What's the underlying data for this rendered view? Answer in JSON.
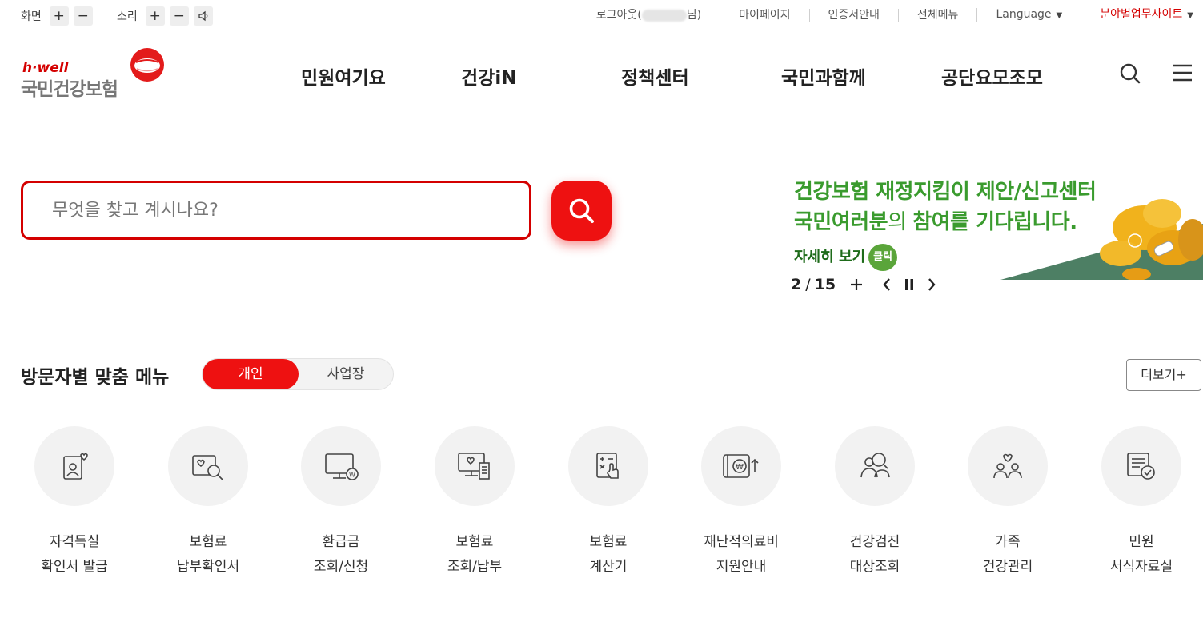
{
  "util": {
    "screen_label": "화면",
    "sound_label": "소리",
    "zoom_in": "+",
    "zoom_out": "−",
    "sound_up": "+",
    "sound_down": "−",
    "logout_prefix": "로그아웃(",
    "logout_suffix": "님)",
    "mypage": "마이페이지",
    "cert": "인증서안내",
    "allmenu": "전체메뉴",
    "language": "Language",
    "business": "분야별업무사이트"
  },
  "logo": {
    "hwell": "h·well",
    "name": "국민건강보험"
  },
  "gnb": {
    "items": [
      "민원여기요",
      "건강iN",
      "정책센터",
      "국민과함께",
      "공단요모조모"
    ]
  },
  "search": {
    "placeholder": "무엇을 찾고 계시나요?"
  },
  "banner": {
    "line1_a": "건강보험 ",
    "line1_b": "재정지킴이 제안/신고센터",
    "line2_a": "국민여러분",
    "line2_b": "의 ",
    "line2_c": "참여를 기다립니다.",
    "more": "자세히 보기",
    "click": "클릭",
    "current": "2",
    "separator": "/",
    "total": "15",
    "plus": "+"
  },
  "visitor_menu": {
    "title": "방문자별 맞춤 메뉴",
    "tab_personal": "개인",
    "tab_business": "사업장",
    "more": "더보기+",
    "items": [
      {
        "line1": "자격득실",
        "line2": "확인서 발급",
        "icon": "person-heart-card-icon"
      },
      {
        "line1": "보험료",
        "line2": "납부확인서",
        "icon": "card-search-icon"
      },
      {
        "line1": "환급금",
        "line2": "조회/신청",
        "icon": "monitor-won-icon"
      },
      {
        "line1": "보험료",
        "line2": "조회/납부",
        "icon": "monitor-receipt-icon"
      },
      {
        "line1": "보험료",
        "line2": "계산기",
        "icon": "calculator-icon"
      },
      {
        "line1": "재난적의료비",
        "line2": "지원안내",
        "icon": "wallet-won-icon"
      },
      {
        "line1": "건강검진",
        "line2": "대상조회",
        "icon": "people-search-icon"
      },
      {
        "line1": "가족",
        "line2": "건강관리",
        "icon": "family-heart-icon"
      },
      {
        "line1": "민원",
        "line2": "서식자료실",
        "icon": "document-check-icon"
      }
    ]
  },
  "colors": {
    "brand_red": "#ee1111",
    "banner_green": "#3a9b2e"
  }
}
